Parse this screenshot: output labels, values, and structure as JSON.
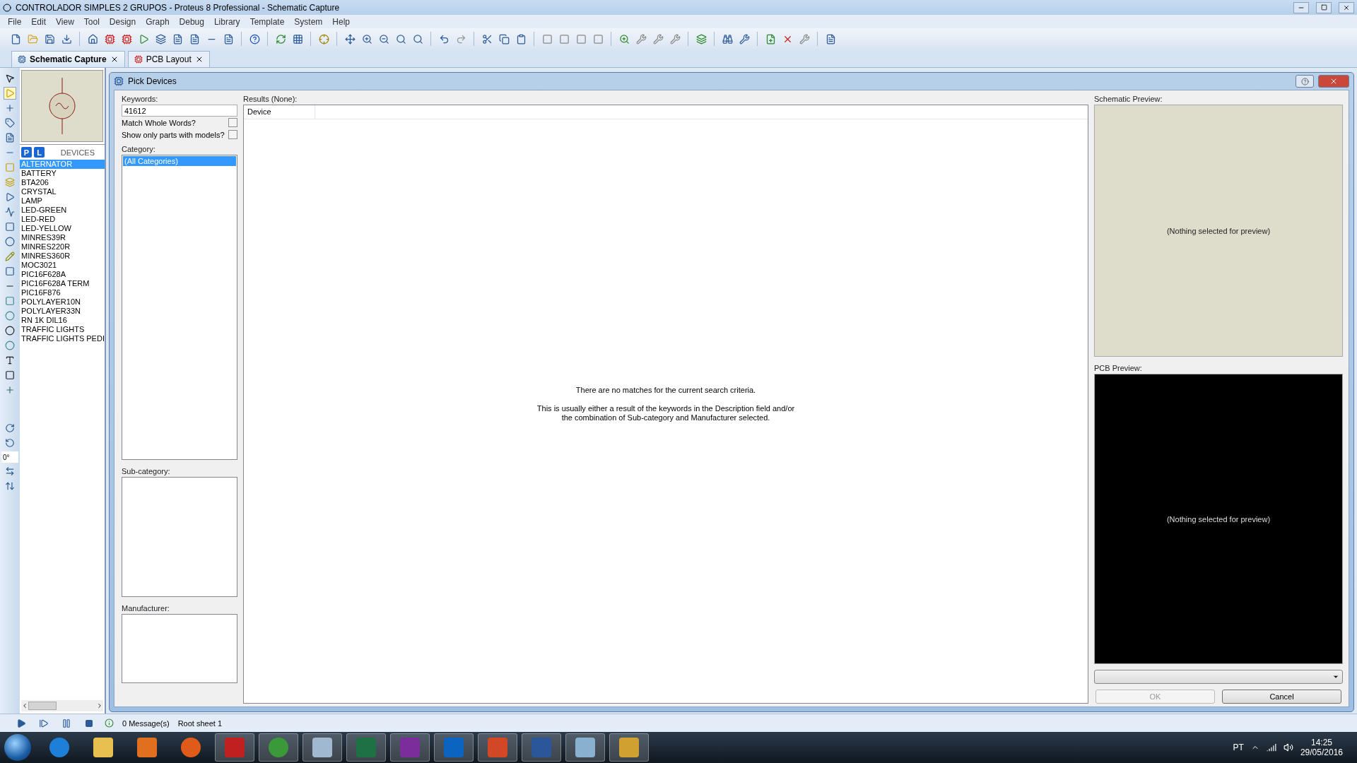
{
  "window": {
    "title": "CONTROLADOR SIMPLES 2 GRUPOS - Proteus 8 Professional - Schematic Capture"
  },
  "menu": [
    "File",
    "Edit",
    "View",
    "Tool",
    "Design",
    "Graph",
    "Debug",
    "Library",
    "Template",
    "System",
    "Help"
  ],
  "tabs": [
    {
      "label": "Schematic Capture",
      "selected": true
    },
    {
      "label": "PCB Layout",
      "selected": false
    }
  ],
  "device_selector": {
    "modes": [
      {
        "label": "P",
        "selected": false
      },
      {
        "label": "L",
        "selected": false
      }
    ],
    "title": "DEVICES",
    "items": [
      {
        "label": "ALTERNATOR",
        "selected": true
      },
      {
        "label": "BATTERY",
        "selected": false
      },
      {
        "label": "BTA206",
        "selected": false
      },
      {
        "label": "CRYSTAL",
        "selected": false
      },
      {
        "label": "LAMP",
        "selected": false
      },
      {
        "label": "LED-GREEN",
        "selected": false
      },
      {
        "label": "LED-RED",
        "selected": false
      },
      {
        "label": "LED-YELLOW",
        "selected": false
      },
      {
        "label": "MINRES39R",
        "selected": false
      },
      {
        "label": "MINRES220R",
        "selected": false
      },
      {
        "label": "MINRES360R",
        "selected": false
      },
      {
        "label": "MOC3021",
        "selected": false
      },
      {
        "label": "PIC16F628A",
        "selected": false
      },
      {
        "label": "PIC16F628A TERM",
        "selected": false
      },
      {
        "label": "PIC16F876",
        "selected": false
      },
      {
        "label": "POLYLAYER10N",
        "selected": false
      },
      {
        "label": "POLYLAYER33N",
        "selected": false
      },
      {
        "label": "RN 1K DIL16",
        "selected": false
      },
      {
        "label": "TRAFFIC LIGHTS",
        "selected": false
      },
      {
        "label": "TRAFFIC LIGHTS PEDI",
        "selected": false
      }
    ]
  },
  "rotation": {
    "value": "0°"
  },
  "dialog": {
    "title": "Pick Devices",
    "keywords": {
      "label": "Keywords:",
      "value": "41612"
    },
    "options": [
      {
        "label": "Match Whole Words?",
        "checked": false
      },
      {
        "label": "Show only parts with models?",
        "checked": false
      }
    ],
    "category": {
      "label": "Category:",
      "items": [
        {
          "label": "(All Categories)",
          "selected": true
        }
      ]
    },
    "subcategory": {
      "label": "Sub-category:"
    },
    "manufacturer": {
      "label": "Manufacturer:"
    },
    "results": {
      "label": "Results (None):",
      "columns": [
        "Device"
      ],
      "message": "There are no matches for the current search criteria.",
      "hint": [
        "This is usually either a result of the keywords in the Description field and/or",
        "the combination of Sub-category and Manufacturer selected."
      ]
    },
    "schematic_preview": {
      "label": "Schematic Preview:",
      "message": "(Nothing selected for preview)"
    },
    "pcb_preview": {
      "label": "PCB Preview:",
      "message": "(Nothing selected for preview)"
    },
    "buttons": [
      {
        "label": "OK",
        "disabled": true
      },
      {
        "label": "Cancel",
        "disabled": false
      }
    ]
  },
  "status_bar": {
    "messages": "0 Message(s)",
    "sheet": "Root sheet 1"
  },
  "taskbar": {
    "language": "PT",
    "time": "14:25",
    "date": "29/05/2016"
  }
}
